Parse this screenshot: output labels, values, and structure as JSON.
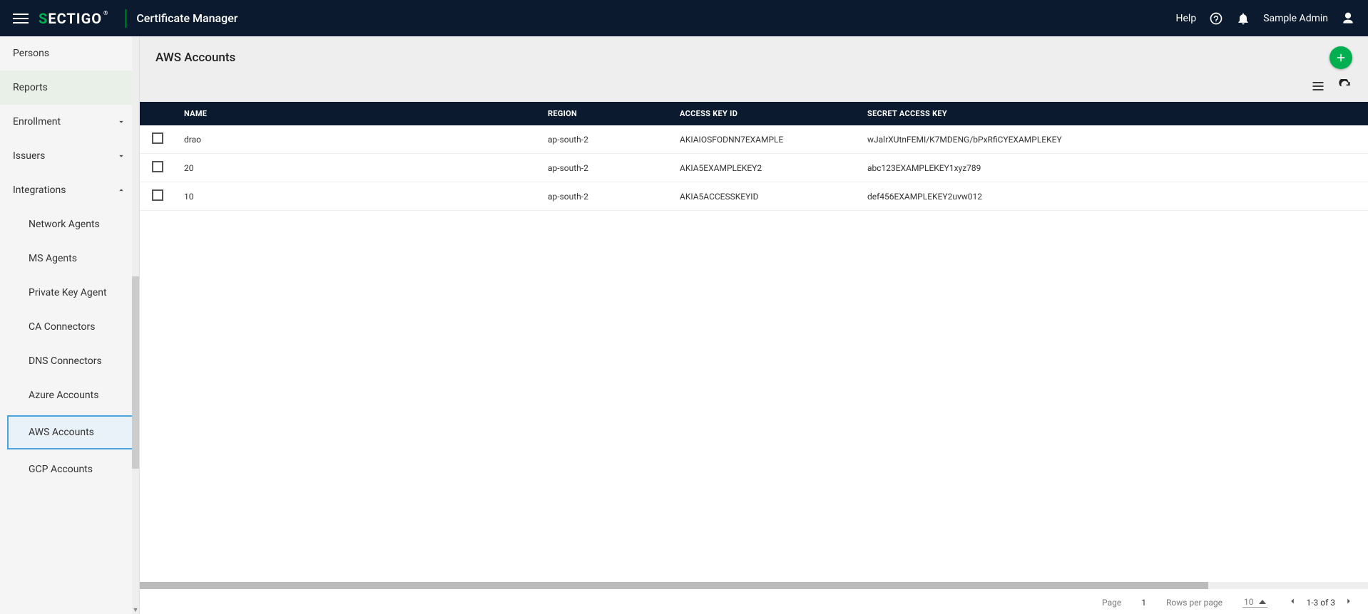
{
  "header": {
    "brand_first": "S",
    "brand_rest": "ECTIGO",
    "reg": "®",
    "app_title": "Certificate Manager",
    "help_label": "Help",
    "user_name": "Sample Admin"
  },
  "sidebar": {
    "items": [
      {
        "label": "Persons",
        "type": "item"
      },
      {
        "label": "Reports",
        "type": "item",
        "highlight": true
      },
      {
        "label": "Enrollment",
        "type": "group",
        "expanded": false
      },
      {
        "label": "Issuers",
        "type": "group",
        "expanded": false
      },
      {
        "label": "Integrations",
        "type": "group",
        "expanded": true
      }
    ],
    "integrations_children": [
      {
        "label": "Network Agents"
      },
      {
        "label": "MS Agents"
      },
      {
        "label": "Private Key Agent"
      },
      {
        "label": "CA Connectors"
      },
      {
        "label": "DNS Connectors"
      },
      {
        "label": "Azure Accounts"
      },
      {
        "label": "AWS Accounts",
        "active": true
      },
      {
        "label": "GCP Accounts"
      }
    ]
  },
  "page": {
    "title": "AWS Accounts"
  },
  "table": {
    "columns": [
      "NAME",
      "REGION",
      "ACCESS KEY ID",
      "SECRET ACCESS KEY"
    ],
    "rows": [
      {
        "name": "drao",
        "region": "ap-south-2",
        "access_key_id": "AKIAIOSFODNN7EXAMPLE",
        "secret": "wJalrXUtnFEMI/K7MDENG/bPxRfiCYEXAMPLEKEY"
      },
      {
        "name": "20",
        "region": "ap-south-2",
        "access_key_id": "AKIA5EXAMPLEKEY2",
        "secret": "abc123EXAMPLEKEY1xyz789"
      },
      {
        "name": "10",
        "region": "ap-south-2",
        "access_key_id": "AKIA5ACCESSKEYID",
        "secret": "def456EXAMPLEKEY2uvw012"
      }
    ]
  },
  "pagination": {
    "page_label": "Page",
    "page_value": "1",
    "rows_label": "Rows per page",
    "rows_value": "10",
    "range": "1-3 of 3"
  }
}
